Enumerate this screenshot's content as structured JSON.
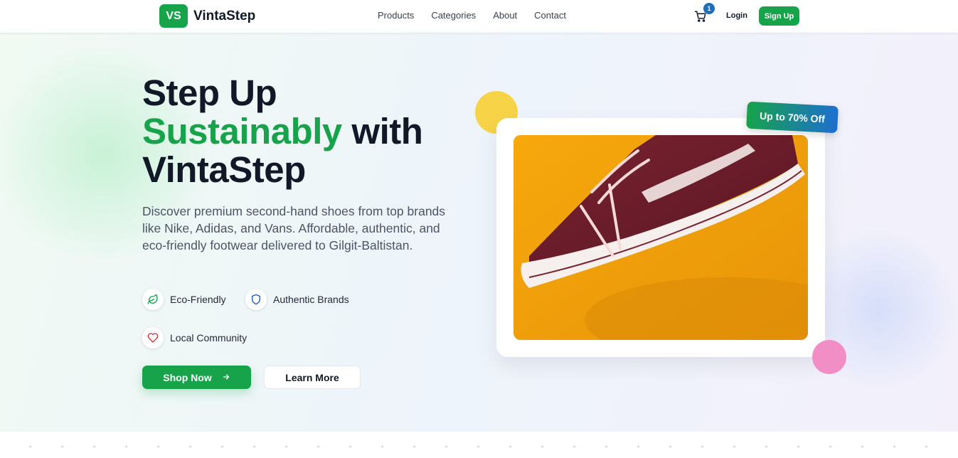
{
  "brand": {
    "badge": "VS",
    "name": "VintaStep",
    "primary_color": "#16a34a",
    "accent_color": "#1e6fb8"
  },
  "nav": {
    "links": [
      "Products",
      "Categories",
      "About",
      "Contact"
    ],
    "cart_icon": "shopping-cart-icon",
    "cart_count": "1",
    "login_label": "Login",
    "signup_label": "Sign Up"
  },
  "hero": {
    "title_line1": "Step Up",
    "title_highlight": "Sustainably",
    "title_line2_rest": " with",
    "title_line3": "VintaStep",
    "description": "Discover premium second-hand shoes from top brands like Nike, Adidas, and Vans. Affordable, authentic, and eco-friendly footwear delivered to Gilgit-Baltistan.",
    "features": [
      {
        "icon": "leaf-icon",
        "label": "Eco-Friendly",
        "color": "#16a34a"
      },
      {
        "icon": "shield-icon",
        "label": "Authentic Brands",
        "color": "#1e4fd0"
      },
      {
        "icon": "heart-icon",
        "label": "Local Community",
        "color": "#dc2626"
      }
    ],
    "shop_label": "Shop Now",
    "shop_icon": "arrow-right-icon",
    "learn_label": "Learn More",
    "discount_label": "Up to 70% Off",
    "image_subject": "burgundy-sneaker-on-orange-background"
  }
}
